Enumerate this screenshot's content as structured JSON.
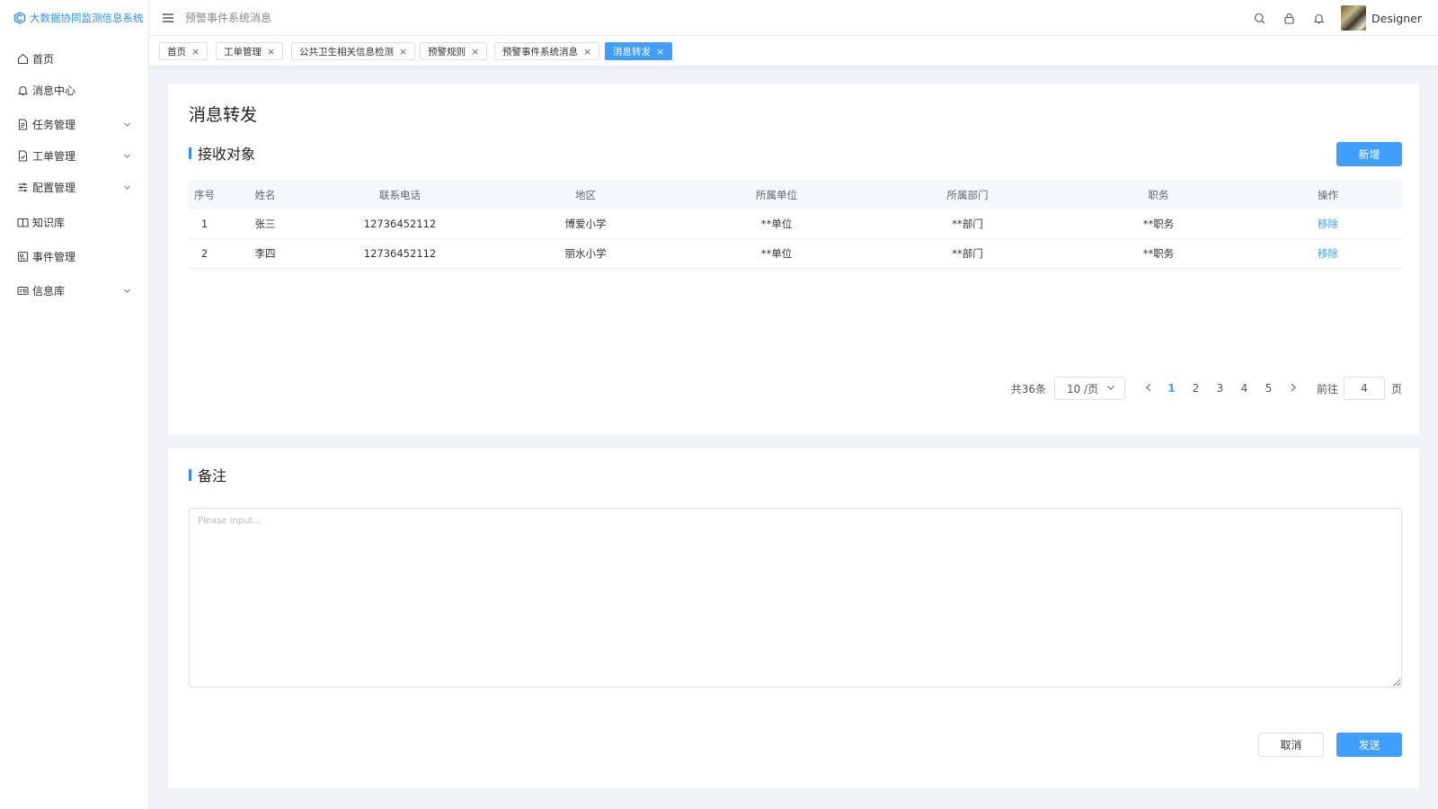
{
  "app": {
    "logo_text": "大数据协同监测信息系统"
  },
  "sidebar": {
    "items": [
      {
        "label": "首页",
        "icon": "home-icon",
        "expandable": false
      },
      {
        "label": "消息中心",
        "icon": "bell-icon",
        "expandable": false
      },
      {
        "label": "任务管理",
        "icon": "document-icon",
        "expandable": true
      },
      {
        "label": "工单管理",
        "icon": "order-icon",
        "expandable": true
      },
      {
        "label": "配置管理",
        "icon": "sliders-icon",
        "expandable": true
      },
      {
        "label": "知识库",
        "icon": "book-icon",
        "expandable": false
      },
      {
        "label": "事件管理",
        "icon": "event-icon",
        "expandable": false
      },
      {
        "label": "信息库",
        "icon": "card-icon",
        "expandable": true
      }
    ]
  },
  "header": {
    "breadcrumb": "预警事件系统消息",
    "user_name": "Designer"
  },
  "tabs": [
    {
      "label": "首页",
      "active": false
    },
    {
      "label": "工单管理",
      "active": false
    },
    {
      "label": "公共卫生相关信息检测",
      "active": false
    },
    {
      "label": "预警规则",
      "active": false
    },
    {
      "label": "预警事件系统消息",
      "active": false
    },
    {
      "label": "消息转发",
      "active": true
    }
  ],
  "page": {
    "title": "消息转发",
    "recipients_section": "接收对象",
    "add_button": "新增",
    "remark_section": "备注",
    "remark_placeholder": "Please input...",
    "cancel_button": "取消",
    "send_button": "发送"
  },
  "table": {
    "headers": [
      "序号",
      "姓名",
      "联系电话",
      "地区",
      "所属单位",
      "所属部门",
      "职务",
      "操作"
    ],
    "rows": [
      [
        "1",
        "张三",
        "12736452112",
        "博爱小学",
        "**单位",
        "**部门",
        "**职务",
        "移除"
      ],
      [
        "2",
        "李四",
        "12736452112",
        "丽水小学",
        "**单位",
        "**部门",
        "**职务",
        "移除"
      ]
    ]
  },
  "pagination": {
    "total_text": "共36条",
    "page_size": "10 /页",
    "pages": [
      "1",
      "2",
      "3",
      "4",
      "5"
    ],
    "current_page": "1",
    "goto_label": "前往",
    "goto_value": "4",
    "goto_suffix": "页"
  },
  "colors": {
    "primary": "#409eff",
    "brand": "#2f8ff3"
  }
}
